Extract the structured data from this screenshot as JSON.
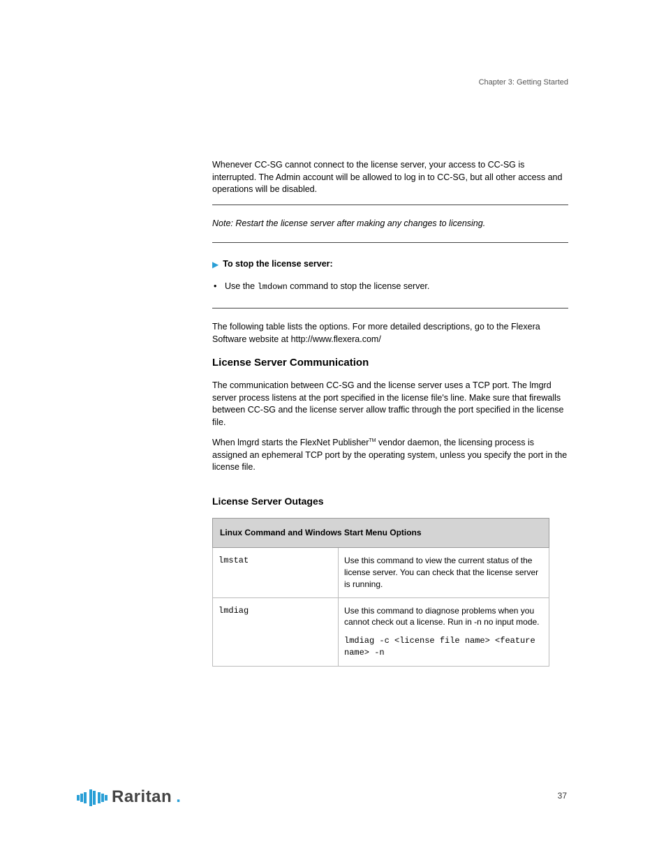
{
  "header": {
    "chapter": "Chapter 3: Getting Started"
  },
  "body": {
    "p1": "Whenever CC-SG cannot connect to the license server, your access to CC-SG is interrupted. The Admin account will be allowed to log in to CC-SG, but all other access and operations will be disabled.",
    "ruleNote": "Note: Restart the license server after making any changes to licensing.",
    "toLabel": "To stop the license server:",
    "bulletPrefix": "Use the ",
    "bulletMono": "lmdown",
    "bulletSuffix": " command to stop the license server.",
    "afterPara": "The following table lists the options. For more detailed descriptions, go to the Flexera Software website at",
    "afterUrl": "http://www.flexera.com/",
    "h2": "License Server Communication",
    "p2": "The communication between CC-SG and the license server uses a TCP port. The lmgrd server process listens at the port specified in the license file's line. Make sure that firewalls between CC-SG and the license server allow traffic through the port specified in the license file.",
    "p3a": "When lmgrd starts the FlexNet Publisher",
    "tm": "TM",
    "p3b": " vendor daemon, the licensing process is assigned an ephemeral TCP port by the operating system, unless you specify the port in the license file.",
    "h3": "License Server Outages"
  },
  "table": {
    "header": "Linux Command and Windows Start Menu Options",
    "rows": [
      {
        "cmd": "lmstat",
        "desc": "Use this command to view the current status of the license server. You can check that the license server is running."
      },
      {
        "cmd": "lmdiag",
        "descA": "Use this command to diagnose problems when you cannot check out a license. Run in -n no input mode.",
        "code": "lmdiag -c <license file name> <feature name> -n"
      }
    ]
  },
  "footer": {
    "logoText": "Raritan",
    "pageNumber": "37"
  }
}
